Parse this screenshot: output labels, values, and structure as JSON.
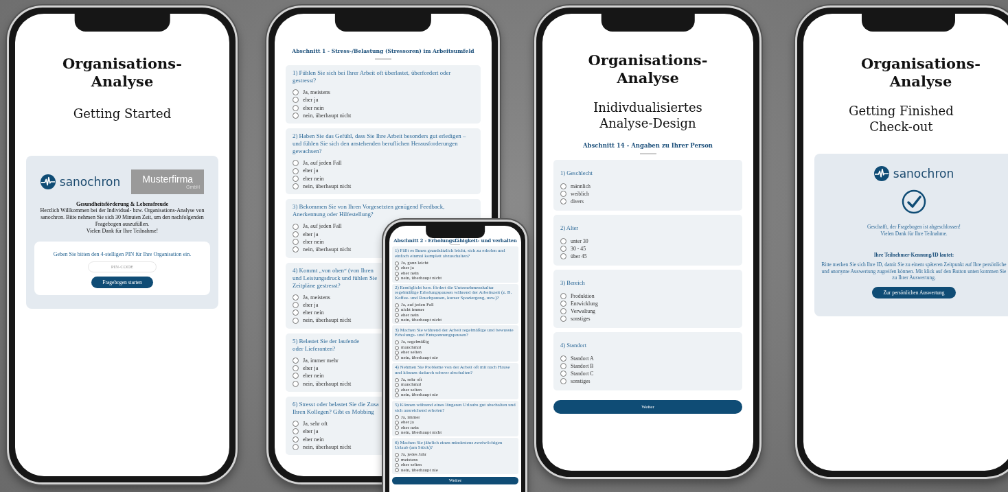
{
  "phones": [
    {
      "kind": "welcome",
      "title": "Organisations-Analyse",
      "subtitle": "Getting Started",
      "brand": "sanochron",
      "partner": {
        "name": "Musterfirma",
        "suffix": "GmbH"
      },
      "heading": "Gesundheitsförderung & Lebensfreude",
      "intro": "Herzlich Willkommen bei der Individual- bzw. Organisations-Analyse von sanochron. Bitte nehmen Sie sich 30 Minuten Zeit, um den nachfolgenden Fragebogen auszufüllen.\nVielen Dank für Ihre Teilnahme!",
      "pin_prompt": "Geben Sie bitten den 4-stelligen PIN für Ihre Organisation ein.",
      "pin": {
        "placeholder": "PIN-CODE"
      },
      "button": "Fragebogen starten"
    },
    {
      "kind": "survey",
      "section": "Abschnitt 1 - Stress-/Belastung (Stressoren) im Arbeitsumfeld",
      "questions": [
        {
          "text": "1) Fühlen Sie sich bei Ihrer Arbeit oft überlastet, überfordert oder gestresst?",
          "options": [
            {
              "label": "Ja, meistens",
              "selected": false
            },
            {
              "label": "eher ja",
              "selected": false
            },
            {
              "label": "eher nein",
              "selected": false
            },
            {
              "label": "nein, überhaupt nicht",
              "selected": false
            }
          ]
        },
        {
          "text": "2) Haben Sie das Gefühl, dass Sie Ihre Arbeit besonders gut erledigen – und fühlen Sie sich den anstehenden beruflichen Herausforderungen gewachsen?",
          "options": [
            {
              "label": "Ja, auf jeden Fall",
              "selected": false
            },
            {
              "label": "eher ja",
              "selected": false
            },
            {
              "label": "eher nein",
              "selected": false
            },
            {
              "label": "nein, überhaupt nicht",
              "selected": false
            }
          ]
        },
        {
          "text": "3) Bekommen Sie von Ihren Vorgesetzten genügend Feedback, Anerkennung oder Hilfestellung?",
          "options": [
            {
              "label": "Ja, auf jeden Fall",
              "selected": false
            },
            {
              "label": "eher ja",
              "selected": false
            },
            {
              "label": "eher nein",
              "selected": false
            },
            {
              "label": "nein, überhaupt nicht",
              "selected": false
            }
          ]
        },
        {
          "text": "4) Kommt „von oben“ (von Ihren\nund Leistungsdruck und fühlen Sie\nZeitpläne gestresst?",
          "options": [
            {
              "label": "Ja, meistens",
              "selected": false
            },
            {
              "label": "eher ja",
              "selected": false
            },
            {
              "label": "eher nein",
              "selected": false
            },
            {
              "label": "nein, überhaupt nicht",
              "selected": false
            }
          ]
        },
        {
          "text": "5) Belastet Sie der laufende\noder Lieferanten?",
          "options": [
            {
              "label": "Ja, immer mehr",
              "selected": false
            },
            {
              "label": "eher ja",
              "selected": false
            },
            {
              "label": "eher nein",
              "selected": false
            },
            {
              "label": "nein, überhaupt nicht",
              "selected": false
            }
          ]
        },
        {
          "text": "6) Stresst oder belastet Sie die Zusa\nIhren Kollegen? Gibt es Mobbing",
          "options": [
            {
              "label": "Ja, sehr oft",
              "selected": false
            },
            {
              "label": "eher ja",
              "selected": false
            },
            {
              "label": "eher nein",
              "selected": false
            },
            {
              "label": "nein, überhaupt nicht",
              "selected": false
            }
          ]
        }
      ]
    },
    {
      "kind": "survey",
      "section": "Abschnitt 2 - Erholungsfähigkeit- und verhalten",
      "questions": [
        {
          "text": "1) Fällt es Ihnen grundsätzlich leicht, sich zu erholen und einfach einmal komplett abzuschalten?",
          "options": [
            {
              "label": "Ja, ganz leicht",
              "selected": false
            },
            {
              "label": "eher ja",
              "selected": false
            },
            {
              "label": "eher nein",
              "selected": false
            },
            {
              "label": "nein, überhaupt nicht",
              "selected": false
            }
          ]
        },
        {
          "text": "2) Ermöglicht bzw. fördert die Unternehmenskultur regelmäßige Erholungspausen während der Arbeitszeit (z. B. Kaffee- und Rauchpausen, kurzer Spaziergang, usw.)?",
          "options": [
            {
              "label": "Ja, auf jeden Fall",
              "selected": false
            },
            {
              "label": "nicht immer",
              "selected": false
            },
            {
              "label": "eher nein",
              "selected": false
            },
            {
              "label": "nein, überhaupt nicht",
              "selected": false
            }
          ]
        },
        {
          "text": "3) Machen Sie während der Arbeit regelmäßige und bewusste Erholungs- und Entspannungspausen?",
          "options": [
            {
              "label": "Ja, regelmäßig",
              "selected": false
            },
            {
              "label": "manchmal",
              "selected": false
            },
            {
              "label": "eher selten",
              "selected": false
            },
            {
              "label": "nein, überhaupt nie",
              "selected": false
            }
          ]
        },
        {
          "text": "4) Nehmen Sie Probleme von der Arbeit oft mit nach Hause und können dadurch schwer abschalten?",
          "options": [
            {
              "label": "Ja, sehr oft",
              "selected": false
            },
            {
              "label": "manchmal",
              "selected": false
            },
            {
              "label": "eher selten",
              "selected": false
            },
            {
              "label": "nein, überhaupt nie",
              "selected": false
            }
          ]
        },
        {
          "text": "5) Können während eines längeren Urlaubs gut abschalten und sich ausreichend erholen?",
          "options": [
            {
              "label": "Ja, immer",
              "selected": false
            },
            {
              "label": "eher ja",
              "selected": false
            },
            {
              "label": "eher nein",
              "selected": false
            },
            {
              "label": "nein, überhaupt nicht",
              "selected": false
            }
          ]
        },
        {
          "text": "6) Machen Sie jährlich einen mindestens zweiwöchigen Urlaub (am Stück)?",
          "options": [
            {
              "label": "Ja, jedes Jahr",
              "selected": false
            },
            {
              "label": "meistens",
              "selected": false
            },
            {
              "label": "eher selten",
              "selected": false
            },
            {
              "label": "nein, überhaupt nie",
              "selected": false
            }
          ]
        }
      ],
      "button": "Weiter"
    },
    {
      "kind": "survey",
      "title": "Organisations-Analyse",
      "subtitle": "Inidivdualisiertes\nAnalyse-Design",
      "section": "Abschnitt 14 - Angaben zu Ihrer Person",
      "questions": [
        {
          "text": "1) Geschlecht",
          "options": [
            {
              "label": "männlich",
              "selected": false
            },
            {
              "label": "weiblich",
              "selected": false
            },
            {
              "label": "divers",
              "selected": false
            }
          ]
        },
        {
          "text": "2) Alter",
          "options": [
            {
              "label": "unter 30",
              "selected": false
            },
            {
              "label": "30 - 45",
              "selected": false
            },
            {
              "label": "über 45",
              "selected": false
            }
          ]
        },
        {
          "text": "3) Bereich",
          "options": [
            {
              "label": "Produktion",
              "selected": false
            },
            {
              "label": "Entwicklung",
              "selected": false
            },
            {
              "label": "Verwaltung",
              "selected": false
            },
            {
              "label": "sonstiges",
              "selected": false
            }
          ]
        },
        {
          "text": "4) Standort",
          "options": [
            {
              "label": "Standort A",
              "selected": false
            },
            {
              "label": "Standort B",
              "selected": false
            },
            {
              "label": "Standort C",
              "selected": false
            },
            {
              "label": "sonstiges",
              "selected": false
            }
          ]
        }
      ],
      "button": "Weiter"
    },
    {
      "kind": "finish",
      "title": "Organisations-Analyse",
      "subtitle": "Getting Finished\nCheck-out",
      "brand": "sanochron",
      "message": "Geschafft, der Fragebogen ist abgeschlossen!\nVielen Dank für Ihre Teilnahme.",
      "id_heading": "Ihre Teilnehmer-Kennung/ID lautet:",
      "info": "Bitte merken Sie sich Ihre ID, damit Sie zu einem späteren Zeitpunkt auf Ihre persönliche und anonyme Auswertung zugreifen können. Mit klick auf den Button unten kommen Sie zu Ihrer Auswertung.",
      "button": "Zur persönlichen Auswertung"
    }
  ]
}
